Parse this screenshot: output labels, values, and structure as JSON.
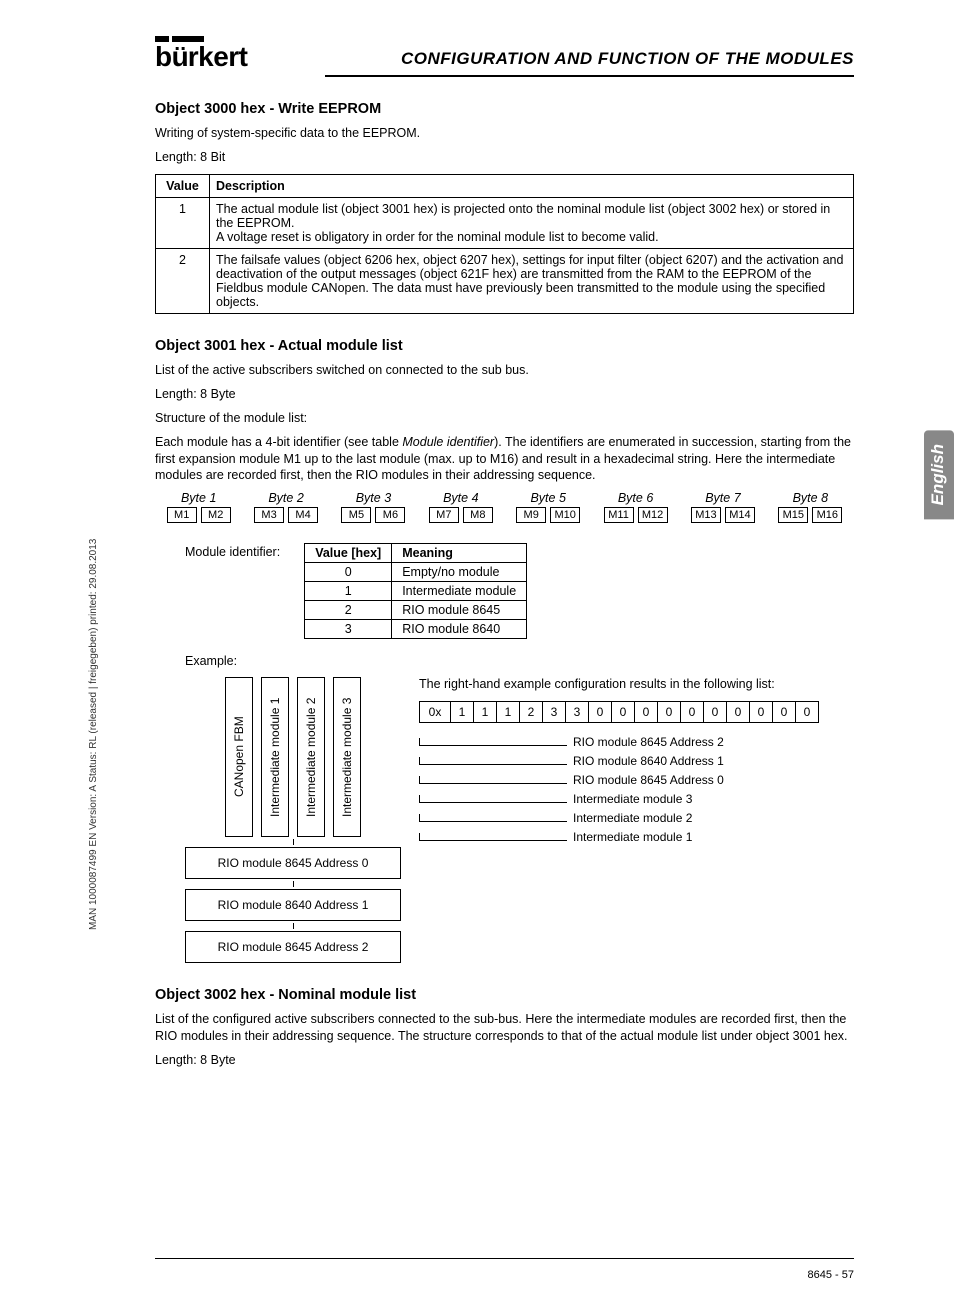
{
  "header": {
    "title": "CONFIGURATION AND FUNCTION OF THE MODULES",
    "logo_text": "burkert"
  },
  "side_tab": "English",
  "vertical_meta": "MAN 1000087499 EN Version: A Status: RL (released | freigegeben) printed: 29.08.2013",
  "sections": {
    "s3000": {
      "heading": "Object 3000 hex - Write EEPROM",
      "p1": "Writing of system-specific data to the EEPROM.",
      "p2": "Length: 8 Bit",
      "table": {
        "h_value": "Value",
        "h_desc": "Description",
        "rows": [
          {
            "value": "1",
            "desc": "The actual module list (object 3001 hex) is projected onto the nominal module list (object 3002 hex) or stored in the EEPROM.\nA voltage reset is obligatory in order for the nominal module list to become valid."
          },
          {
            "value": "2",
            "desc": "The failsafe values (object 6206 hex, object 6207 hex), settings for input filter (object 6207) and the activation and deactivation of the output messages (object 621F hex) are transmitted from the RAM to the EEPROM of the Fieldbus module CANopen. The data must have previously been transmitted to the module using the specified objects."
          }
        ]
      }
    },
    "s3001": {
      "heading": "Object 3001 hex - Actual module list",
      "p1": "List of the active subscribers switched on connected to the sub bus.",
      "p2": "Length: 8 Byte",
      "p3": "Structure of the module list:",
      "p4_a": "Each module has a 4-bit identifier (see table ",
      "p4_i": "Module identifier",
      "p4_b": "). The identifiers are enumerated in succession, starting from the first expansion module M1 up to the last module (max. up to M16) and result in a hexadecimal string. Here the intermediate modules are recorded first, then the RIO modules in their addressing sequence.",
      "bytes": [
        "Byte 1",
        "Byte 2",
        "Byte 3",
        "Byte 4",
        "Byte 5",
        "Byte 6",
        "Byte 7",
        "Byte 8"
      ],
      "mcells": [
        "M1",
        "M2",
        "M3",
        "M4",
        "M5",
        "M6",
        "M7",
        "M8",
        "M9",
        "M10",
        "M11",
        "M12",
        "M13",
        "M14",
        "M15",
        "M16"
      ],
      "ident_label": "Module identifier:",
      "ident": {
        "h_value": "Value [hex]",
        "h_meaning": "Meaning",
        "rows": [
          {
            "v": "0",
            "m": "Empty/no module"
          },
          {
            "v": "1",
            "m": "Intermediate module"
          },
          {
            "v": "2",
            "m": "RIO module 8645"
          },
          {
            "v": "3",
            "m": "RIO module 8640"
          }
        ]
      },
      "example_label": "Example:",
      "diagram": {
        "fbm": "CANopen FBM",
        "im1": "Intermediate module 1",
        "im2": "Intermediate module 2",
        "im3": "Intermediate module 3",
        "r0": "RIO module 8645 Address 0",
        "r1": "RIO module 8640 Address 1",
        "r2": "RIO module 8645 Address 2"
      },
      "right_example_text": "The right-hand example configuration results in the following list:",
      "hex": [
        "0x",
        "1",
        "1",
        "1",
        "2",
        "3",
        "3",
        "0",
        "0",
        "0",
        "0",
        "0",
        "0",
        "0",
        "0",
        "0",
        "0"
      ],
      "annotations": [
        {
          "indent": 162,
          "label": "RIO module 8645 Address 2"
        },
        {
          "indent": 162,
          "label": "RIO module 8640 Address 1"
        },
        {
          "indent": 162,
          "label": "RIO module 8645 Address 0"
        },
        {
          "indent": 162,
          "label": "Intermediate module 3"
        },
        {
          "indent": 162,
          "label": "Intermediate module 2"
        },
        {
          "indent": 162,
          "label": "Intermediate module 1"
        }
      ]
    },
    "s3002": {
      "heading": "Object 3002 hex - Nominal module list",
      "p1": "List of the configured active subscribers connected to the sub-bus. Here the intermediate modules are recorded first, then the RIO modules in their addressing sequence. The structure corresponds to that of the actual module list under object 3001 hex.",
      "p2": "Length: 8 Byte"
    }
  },
  "footer": "8645  -  57"
}
